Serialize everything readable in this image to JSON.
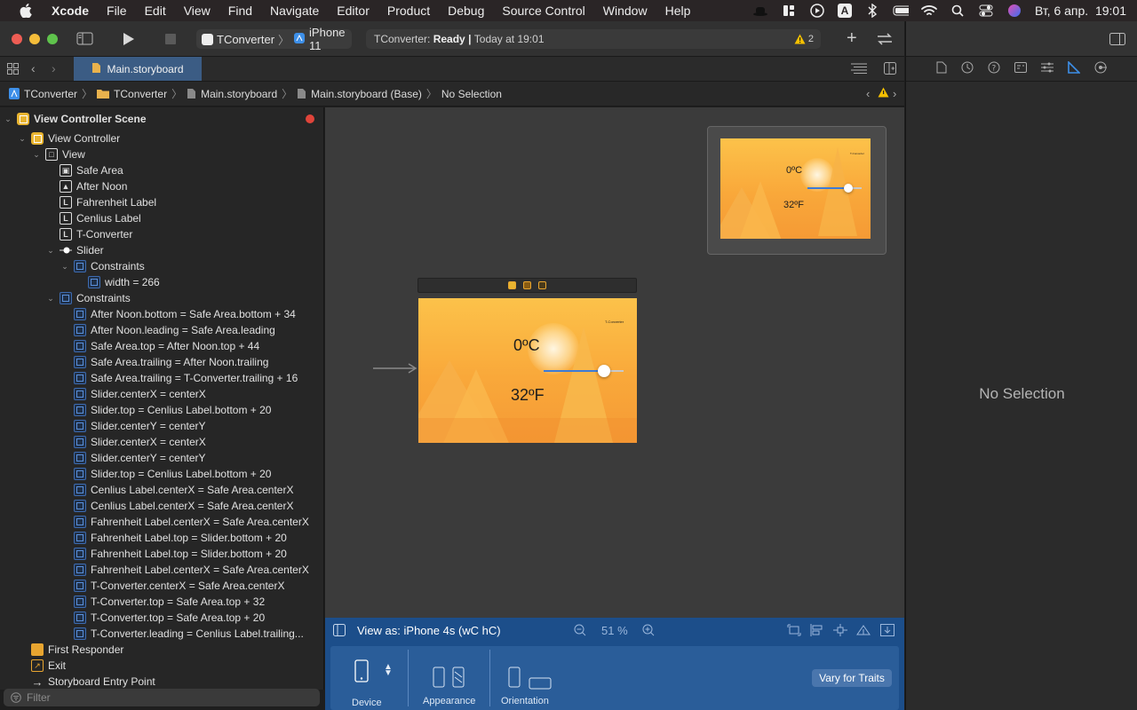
{
  "menubar": {
    "app_name": "Xcode",
    "items": [
      "File",
      "Edit",
      "View",
      "Find",
      "Navigate",
      "Editor",
      "Product",
      "Debug",
      "Source Control",
      "Window",
      "Help"
    ],
    "clock": "Вт, 6 апр.  19:01",
    "keyboard_layout": "A"
  },
  "toolbar": {
    "scheme_target": "TConverter",
    "scheme_device": "iPhone 11",
    "activity_prefix": "TConverter:",
    "activity_status": "Ready",
    "activity_time": "Today at 19:01",
    "warning_count": "2"
  },
  "tabbar": {
    "active_tab": "Main.storyboard"
  },
  "jumpbar": {
    "crumbs": [
      "TConverter",
      "TConverter",
      "Main.storyboard",
      "Main.storyboard (Base)",
      "No Selection"
    ]
  },
  "outline": {
    "rows": [
      {
        "label": "View Controller Scene",
        "bold": true
      },
      {
        "label": "View Controller"
      },
      {
        "label": "View"
      },
      {
        "label": "Safe Area"
      },
      {
        "label": "After Noon"
      },
      {
        "label": "Fahrenheit Label"
      },
      {
        "label": "Cenlius Label"
      },
      {
        "label": "T-Converter"
      },
      {
        "label": "Slider"
      },
      {
        "label": "Constraints"
      },
      {
        "label": "width = 266"
      },
      {
        "label": "Constraints"
      },
      {
        "label": "After Noon.bottom = Safe Area.bottom + 34"
      },
      {
        "label": "After Noon.leading = Safe Area.leading"
      },
      {
        "label": "Safe Area.top = After Noon.top + 44"
      },
      {
        "label": "Safe Area.trailing = After Noon.trailing"
      },
      {
        "label": "Safe Area.trailing = T-Converter.trailing + 16"
      },
      {
        "label": "Slider.centerX = centerX"
      },
      {
        "label": "Slider.top = Cenlius Label.bottom + 20"
      },
      {
        "label": "Slider.centerY = centerY"
      },
      {
        "label": "Slider.centerX = centerX"
      },
      {
        "label": "Slider.centerY = centerY"
      },
      {
        "label": "Slider.top = Cenlius Label.bottom + 20"
      },
      {
        "label": "Cenlius Label.centerX = Safe Area.centerX"
      },
      {
        "label": "Cenlius Label.centerX = Safe Area.centerX"
      },
      {
        "label": "Fahrenheit Label.centerX = Safe Area.centerX"
      },
      {
        "label": "Fahrenheit Label.top = Slider.bottom + 20"
      },
      {
        "label": "Fahrenheit Label.top = Slider.bottom + 20"
      },
      {
        "label": "Fahrenheit Label.centerX = Safe Area.centerX"
      },
      {
        "label": "T-Converter.centerX = Safe Area.centerX"
      },
      {
        "label": "T-Converter.top = Safe Area.top + 32"
      },
      {
        "label": "T-Converter.top = Safe Area.top + 20"
      },
      {
        "label": "T-Converter.leading = Cenlius Label.trailing..."
      },
      {
        "label": "First Responder"
      },
      {
        "label": "Exit"
      },
      {
        "label": "Storyboard Entry Point"
      }
    ],
    "filter_placeholder": "Filter"
  },
  "canvas": {
    "scene_title": "T-Converter",
    "celsius": "0ºC",
    "fahrenheit": "32ºF",
    "slider_fraction": 0.75
  },
  "devicebar": {
    "view_as": "View as: iPhone 4s (wC hC)",
    "zoom": "51 %",
    "device_label": "Device",
    "appearance_label": "Appearance",
    "orientation_label": "Orientation",
    "vary_button": "Vary for Traits"
  },
  "inspector": {
    "no_selection": "No Selection"
  },
  "colors": {
    "accent": "#3b5c84",
    "bottom_bar": "#1c4e8a",
    "scene_top": "#fcc24a",
    "scene_bottom": "#f59a35",
    "warning": "#f5c000",
    "error": "#e0443a"
  }
}
